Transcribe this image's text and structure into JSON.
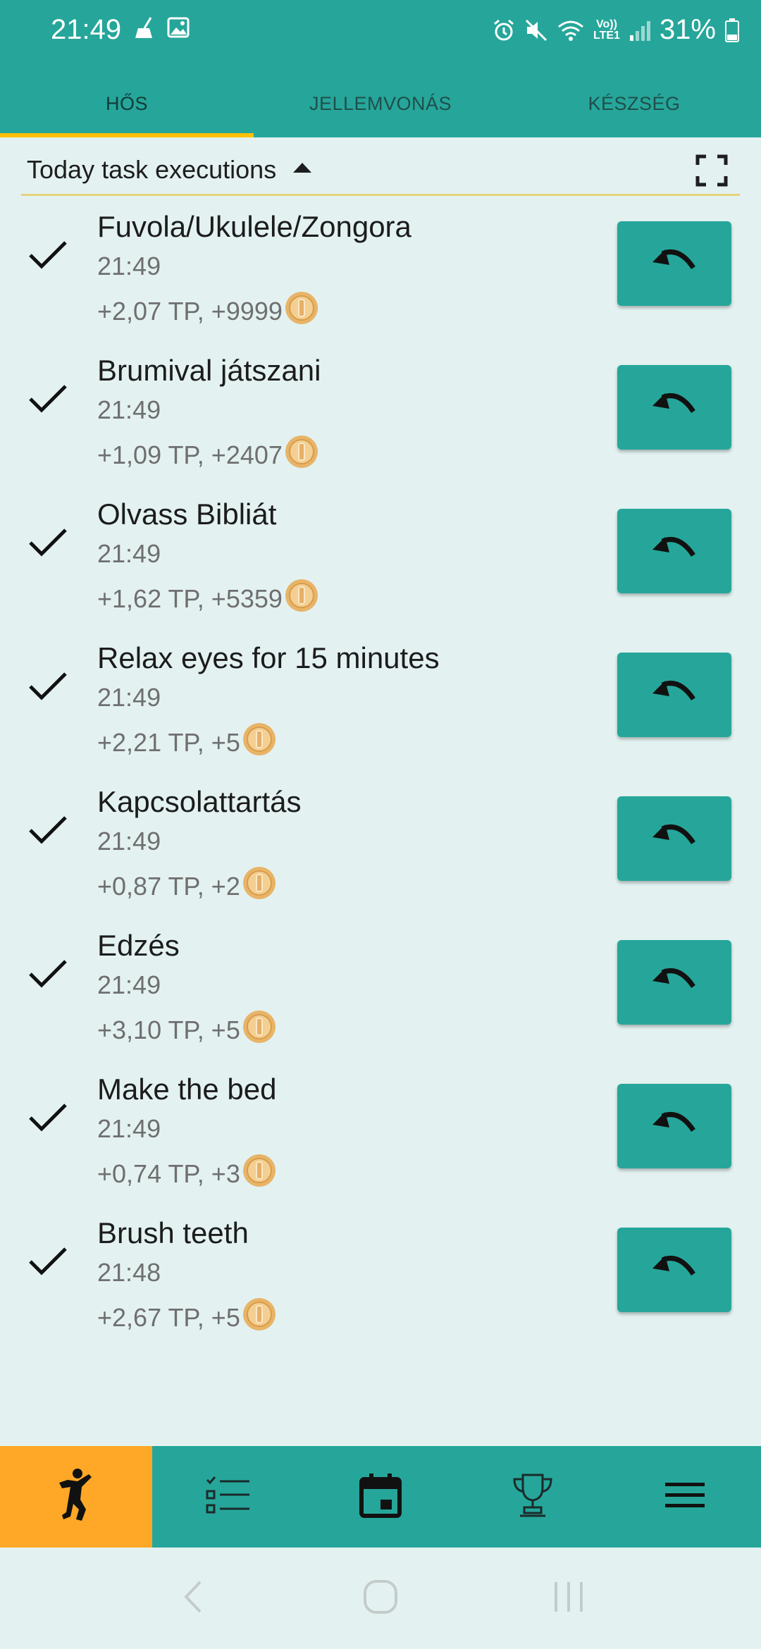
{
  "status_bar": {
    "time": "21:49",
    "left_icons": [
      "broom-icon",
      "image-icon"
    ],
    "right_icons": [
      "alarm-icon",
      "mute-icon",
      "wifi-icon",
      "volte-icon",
      "signal-icon",
      "battery-icon"
    ],
    "volte_label_top": "Vo))",
    "volte_label_bottom": "LTE1",
    "battery": "31%"
  },
  "tabs": [
    {
      "label": "HŐS",
      "active": true
    },
    {
      "label": "JELLEMVONÁS",
      "active": false
    },
    {
      "label": "KÉSZSÉG",
      "active": false
    }
  ],
  "section": {
    "title": "Today task executions",
    "caret_icon": "caret-up-icon",
    "fullscreen_icon": "fullscreen-icon"
  },
  "tasks": [
    {
      "title": "Fuvola/Ukulele/Zongora",
      "time": "21:49",
      "reward": "+2,07 TP, +9999"
    },
    {
      "title": "Brumival játszani",
      "time": "21:49",
      "reward": "+1,09 TP, +2407"
    },
    {
      "title": "Olvass Bibliát",
      "time": "21:49",
      "reward": "+1,62 TP, +5359"
    },
    {
      "title": "Relax eyes for 15 minutes",
      "time": "21:49",
      "reward": "+2,21 TP, +5"
    },
    {
      "title": "Kapcsolattartás",
      "time": "21:49",
      "reward": "+0,87 TP, +2"
    },
    {
      "title": "Edzés",
      "time": "21:49",
      "reward": "+3,10 TP, +5"
    },
    {
      "title": "Make the bed",
      "time": "21:49",
      "reward": "+0,74 TP, +3"
    },
    {
      "title": "Brush teeth",
      "time": "21:48",
      "reward": "+2,67 TP, +5"
    }
  ],
  "bottom_nav": [
    {
      "icon": "hero-figure-icon",
      "active": true
    },
    {
      "icon": "checklist-icon",
      "active": false
    },
    {
      "icon": "calendar-icon",
      "active": false
    },
    {
      "icon": "trophy-icon",
      "active": false
    },
    {
      "icon": "menu-icon",
      "active": false
    }
  ],
  "system_nav": [
    "back-icon",
    "home-icon",
    "recents-icon"
  ],
  "colors": {
    "primary": "#26a69a",
    "accent": "#ffc107",
    "active_nav": "#ffa726",
    "background": "#e3f2f1",
    "coin": "#e8b468"
  }
}
